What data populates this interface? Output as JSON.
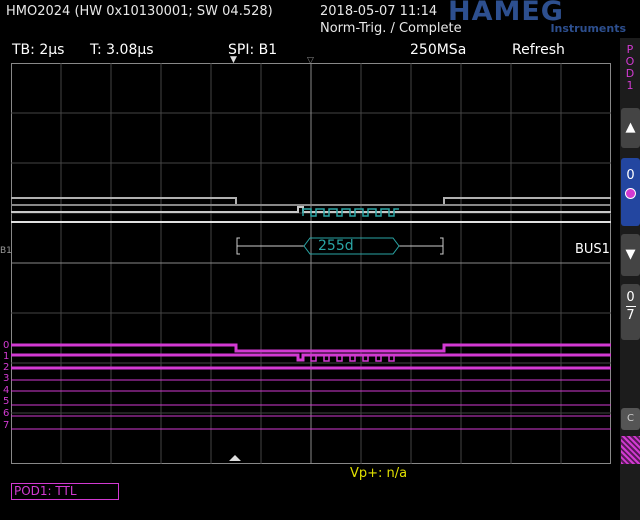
{
  "header": {
    "device": "HMO2024 (HW 0x10130001; SW 04.528)",
    "datetime": "2018-05-07 11:14",
    "trigger_state": "Norm-Trig. / Complete",
    "logo": "HAMEG",
    "logo_sub": "Instruments"
  },
  "status_bar": {
    "timebase": "TB: 2µs",
    "trigger_time": "T: 3.08µs",
    "bus": "SPI: B1",
    "sample_rate": "250MSa",
    "mode": "Refresh"
  },
  "sidebar": {
    "pod_label": "POD1",
    "up": "▲",
    "value": "0",
    "down": "▼",
    "range_top": "0",
    "range_bottom": "7",
    "extra": "C"
  },
  "waveform": {
    "bus_label": "BUS1",
    "b1_marker": "B1",
    "decoded_value": "255d",
    "channel_labels": [
      "0",
      "1",
      "2",
      "3",
      "4",
      "5",
      "6",
      "7"
    ]
  },
  "footer": {
    "vp": "Vp+: n/a",
    "pod_mode": "POD1: TTL"
  },
  "colors": {
    "digital": "#d23ad2",
    "bus": "#2aa5a5",
    "grid": "#555555",
    "logo": "#2d4f8f"
  }
}
